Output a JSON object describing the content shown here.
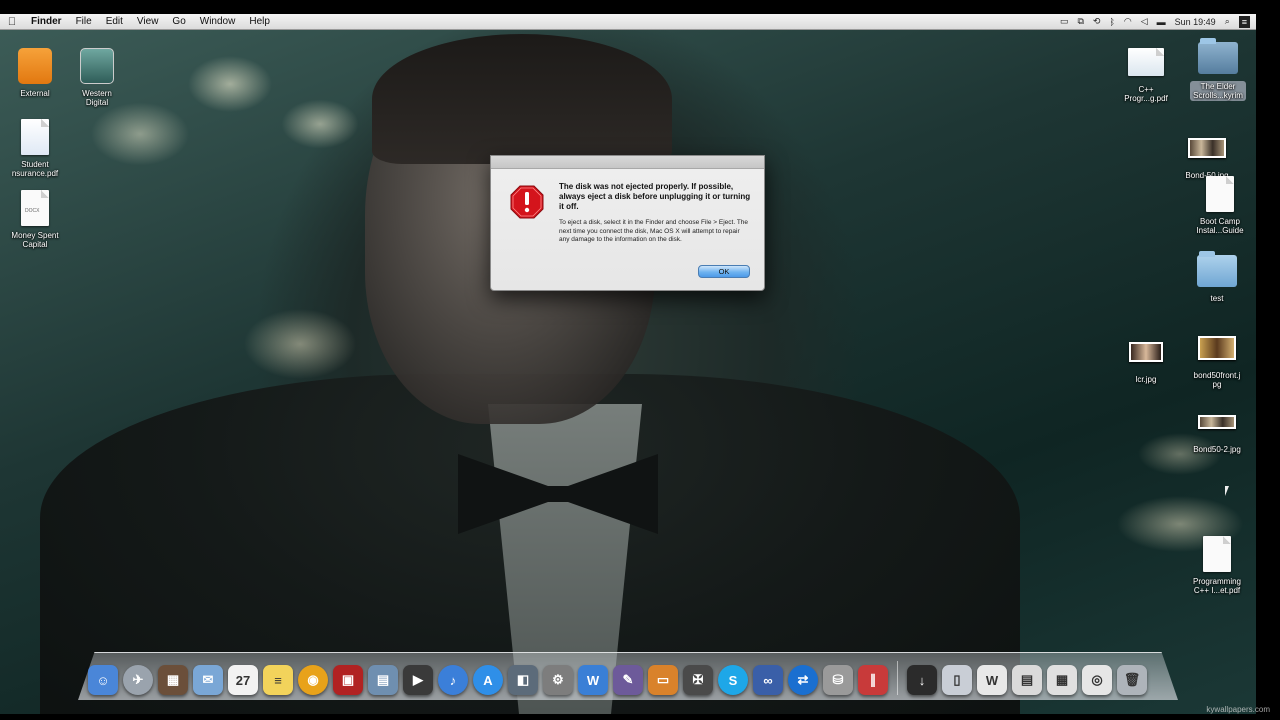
{
  "menubar": {
    "apple": "",
    "app_name": "Finder",
    "menus": [
      "File",
      "Edit",
      "View",
      "Go",
      "Window",
      "Help"
    ],
    "status_icons": [
      "display-icon",
      "share-icon",
      "time-machine-icon",
      "bluetooth-icon",
      "wifi-icon",
      "volume-icon",
      "battery-icon"
    ],
    "clock": "Sun 19:49"
  },
  "desktop_left": [
    {
      "label": "External",
      "icon": "usb-drive-icon"
    },
    {
      "label": "Western\nDigital",
      "icon": "time-machine-drive-icon"
    },
    {
      "label": "Student\nnsurance.pdf",
      "icon": "pdf-document-icon"
    },
    {
      "label": "Money Spent\nCapital",
      "icon": "docx-document-icon",
      "tag": "DOCX"
    }
  ],
  "desktop_right": [
    {
      "label": "C++\nProgr...g.pdf",
      "icon": "pdf-document-icon"
    },
    {
      "label": "The Elder\nScrolls...kyrim",
      "icon": "app-folder-icon"
    },
    {
      "label": "Bond-50.jpg",
      "icon": "image-thumbnail-icon"
    },
    {
      "label": "Boot Camp\nInstal...Guide",
      "icon": "pdf-document-icon"
    },
    {
      "label": "test",
      "icon": "folder-icon"
    },
    {
      "label": "lcr.jpg",
      "icon": "image-thumbnail-icon"
    },
    {
      "label": "bond50front.j\npg",
      "icon": "image-thumbnail-icon"
    },
    {
      "label": "Bond50-2.jpg",
      "icon": "image-thumbnail-icon"
    },
    {
      "label": "Programming\nC++ I...et.pdf",
      "icon": "pdf-document-icon"
    }
  ],
  "alert": {
    "title": "The disk was not ejected properly. If possible, always eject a disk before unplugging it or turning it off.",
    "body": "To eject a disk, select it in the Finder and choose File > Eject. The next time you connect the disk, Mac OS X will attempt to repair any damage to the information on the disk.",
    "ok_label": "OK",
    "icon": "warning-stop-icon"
  },
  "dock": [
    {
      "name": "finder",
      "color": "#4a86d8",
      "glyph": "☺"
    },
    {
      "name": "launchpad",
      "color": "#9aa3ad",
      "glyph": "✈"
    },
    {
      "name": "photo-booth",
      "color": "#6b4f3a",
      "glyph": "▦"
    },
    {
      "name": "mail",
      "color": "#7aa7d6",
      "glyph": "✉"
    },
    {
      "name": "calendar",
      "color": "#f2f2f2",
      "glyph": "27"
    },
    {
      "name": "stickies",
      "color": "#f2d35b",
      "glyph": "≡"
    },
    {
      "name": "chrome",
      "color": "#e8a21a",
      "glyph": "◉"
    },
    {
      "name": "photo-app",
      "color": "#b12222",
      "glyph": "▣"
    },
    {
      "name": "iphoto",
      "color": "#6f8fb0",
      "glyph": "▤"
    },
    {
      "name": "final-cut",
      "color": "#3a3a3a",
      "glyph": "▶"
    },
    {
      "name": "itunes",
      "color": "#3b7fd9",
      "glyph": "♪"
    },
    {
      "name": "app-store",
      "color": "#2f8fe8",
      "glyph": "A"
    },
    {
      "name": "preview",
      "color": "#5c6b7a",
      "glyph": "◧"
    },
    {
      "name": "system-preferences",
      "color": "#7d7d7d",
      "glyph": "⚙"
    },
    {
      "name": "word",
      "color": "#3a7fd6",
      "glyph": "W"
    },
    {
      "name": "brush-app",
      "color": "#6d5a9a",
      "glyph": "✎"
    },
    {
      "name": "keynote",
      "color": "#d9822b",
      "glyph": "▭"
    },
    {
      "name": "skyrim",
      "color": "#4a4a4a",
      "glyph": "✠"
    },
    {
      "name": "skype",
      "color": "#1ea7e8",
      "glyph": "S"
    },
    {
      "name": "infinity-app",
      "color": "#3a5fa8",
      "glyph": "∞"
    },
    {
      "name": "teamviewer",
      "color": "#1a6fd0",
      "glyph": "⇄"
    },
    {
      "name": "disk-utility",
      "color": "#9a9a9a",
      "glyph": "⛁"
    },
    {
      "name": "parallels",
      "color": "#c83a3a",
      "glyph": "∥"
    },
    {
      "name": "sep",
      "color": "",
      "glyph": ""
    },
    {
      "name": "stack-downloads",
      "color": "#2b2b2b",
      "glyph": "↓"
    },
    {
      "name": "stack-documents",
      "color": "#c9ced6",
      "glyph": "▯"
    },
    {
      "name": "stack-word-docs",
      "color": "#e8e8e8",
      "glyph": "W"
    },
    {
      "name": "stack-files",
      "color": "#dadada",
      "glyph": "▤"
    },
    {
      "name": "stack-screens",
      "color": "#e0e0e0",
      "glyph": "▦"
    },
    {
      "name": "stack-browser",
      "color": "#e6e6e6",
      "glyph": "◎"
    },
    {
      "name": "trash",
      "color": "#aeb4ba",
      "glyph": "🗑"
    }
  ],
  "watermark": "kywallpapers.com"
}
